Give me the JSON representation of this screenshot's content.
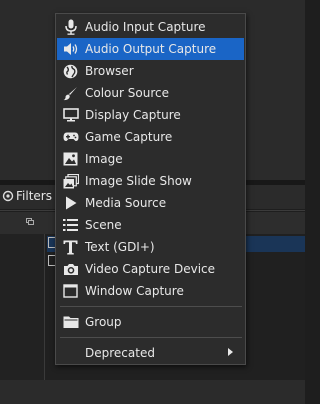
{
  "background": {
    "filters_label": "Filters"
  },
  "menu": {
    "items": [
      {
        "label": "Audio Input Capture",
        "icon": "microphone-icon"
      },
      {
        "label": "Audio Output Capture",
        "icon": "speaker-icon",
        "highlighted": true
      },
      {
        "label": "Browser",
        "icon": "globe-icon"
      },
      {
        "label": "Colour Source",
        "icon": "paintbrush-icon"
      },
      {
        "label": "Display Capture",
        "icon": "monitor-icon"
      },
      {
        "label": "Game Capture",
        "icon": "gamepad-icon"
      },
      {
        "label": "Image",
        "icon": "image-icon"
      },
      {
        "label": "Image Slide Show",
        "icon": "slideshow-icon"
      },
      {
        "label": "Media Source",
        "icon": "play-icon"
      },
      {
        "label": "Scene",
        "icon": "list-icon"
      },
      {
        "label": "Text (GDI+)",
        "icon": "text-icon"
      },
      {
        "label": "Video Capture Device",
        "icon": "camera-icon"
      },
      {
        "label": "Window Capture",
        "icon": "window-icon"
      },
      {
        "label": "Group",
        "icon": "folder-icon"
      },
      {
        "label": "Deprecated",
        "icon": null,
        "submenu": true
      }
    ]
  },
  "colors": {
    "highlight": "#1a65c6",
    "menu_bg": "#2c2c2c",
    "text": "#e8e8e8"
  }
}
